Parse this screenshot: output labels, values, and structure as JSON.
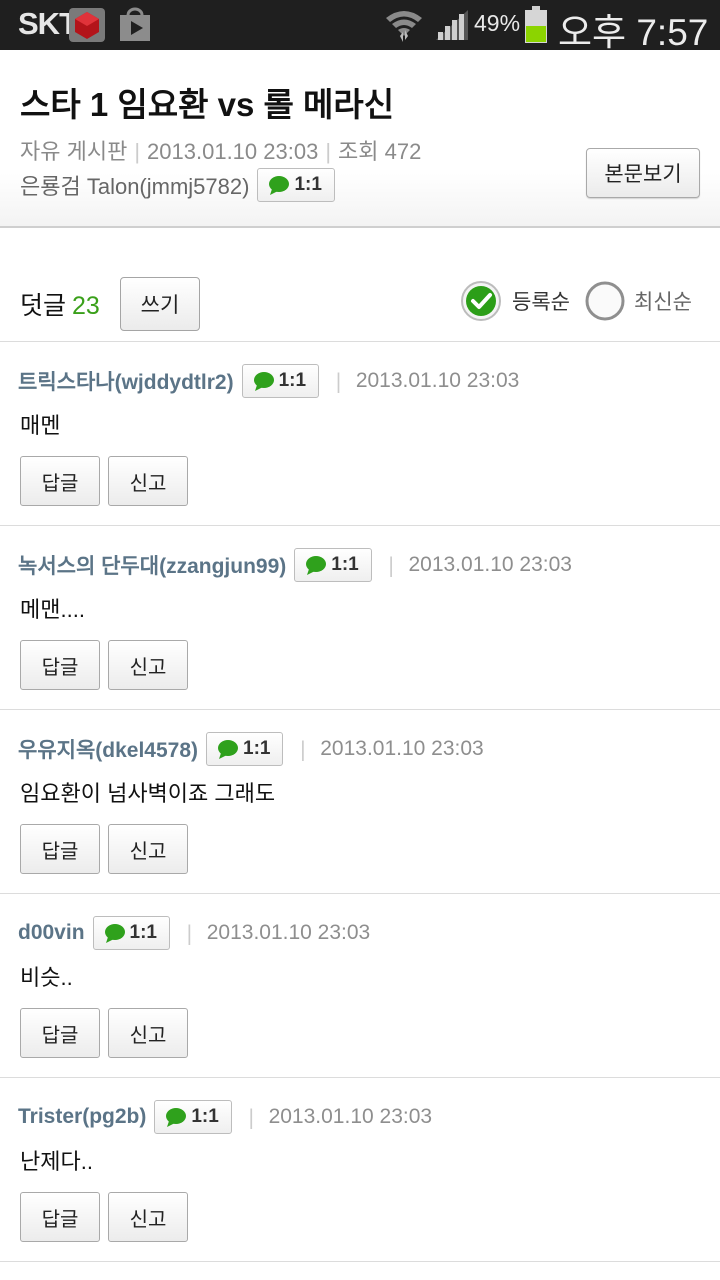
{
  "status_bar": {
    "carrier": "SKT",
    "battery_percent": "49%",
    "time": "오후 7:57"
  },
  "article": {
    "title": "스타 1 임요환 vs 롤 메라신",
    "board": "자유 게시판",
    "datetime": "2013.01.10 23:03",
    "views": "조회 472",
    "author": "은룡검 Talon(jmmj5782)",
    "chat_badge": "1:1",
    "view_original_label": "본문보기"
  },
  "comments_header": {
    "label": "덧글",
    "count": "23",
    "write_label": "쓰기",
    "sort_registered": "등록순",
    "sort_latest": "최신순",
    "selected_sort": "등록순"
  },
  "comments": [
    {
      "author": "트릭스타나(wjddydtlr2)",
      "badge": "1:1",
      "date": "2013.01.10 23:03",
      "body": "매멘",
      "reply_label": "답글",
      "report_label": "신고"
    },
    {
      "author": "녹서스의 단두대(zzangjun99)",
      "badge": "1:1",
      "date": "2013.01.10 23:03",
      "body": "메맨....",
      "reply_label": "답글",
      "report_label": "신고"
    },
    {
      "author": "우유지옥(dkel4578)",
      "badge": "1:1",
      "date": "2013.01.10 23:03",
      "body": "임요환이 넘사벽이죠 그래도",
      "reply_label": "답글",
      "report_label": "신고"
    },
    {
      "author": "d00vin",
      "badge": "1:1",
      "date": "2013.01.10 23:03",
      "body": "비슷..",
      "reply_label": "답글",
      "report_label": "신고"
    },
    {
      "author": "Trister(pg2b)",
      "badge": "1:1",
      "date": "2013.01.10 23:03",
      "body": "난제다..",
      "reply_label": "답글",
      "report_label": "신고"
    }
  ],
  "colors": {
    "accent_green": "#3aa01a",
    "author_blue": "#5b7487",
    "status_bar_bg": "#1f1f1f"
  }
}
